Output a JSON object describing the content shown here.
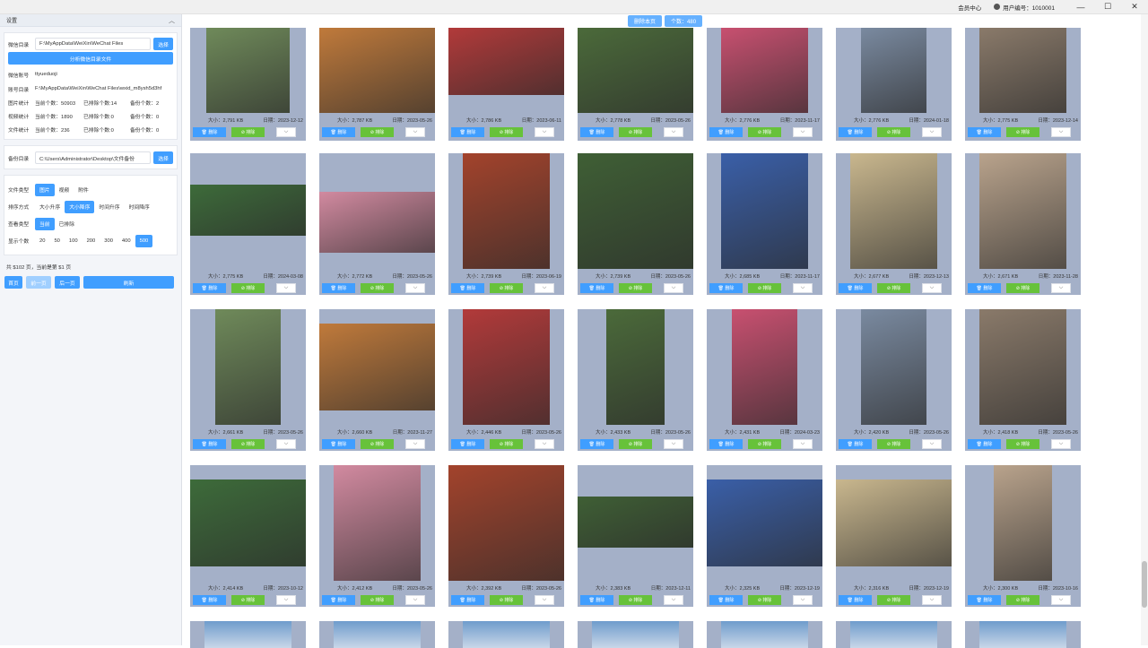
{
  "titlebar": {
    "member": "会员中心",
    "user": "用户编号：1010001",
    "min": "—",
    "max": "☐",
    "close": "✕"
  },
  "settings": {
    "title": "设置",
    "wechat_dir_label": "微信目录",
    "wechat_dir_value": "F:\\MyAppData\\WeiXin\\WeChat Files",
    "select_label": "选择",
    "analyze_label": "分析微信目录文件",
    "account_label": "微信账号",
    "account_value": "ttyueduoji",
    "acct_dir_label": "账号目录",
    "acct_dir_value": "F:\\MyAppData\\WeiXin\\WeChat Files\\wxid_m8ysh5d3hf",
    "stats": [
      {
        "label": "图片统计",
        "current": "当前个数：50903",
        "excluded": "已排除个数:14",
        "backup": "备份个数：2"
      },
      {
        "label": "视频统计",
        "current": "当前个数：1890",
        "excluded": "已排除个数:0",
        "backup": "备份个数：0"
      },
      {
        "label": "文件统计",
        "current": "当前个数：236",
        "excluded": "已排除个数:0",
        "backup": "备份个数：0"
      }
    ],
    "backup_dir_label": "备份目录",
    "backup_dir_value": "C:\\Users\\Administrator\\Desktop\\文件备份",
    "backup_select_label": "选择"
  },
  "filters": {
    "file_type_label": "文件类型",
    "file_types": [
      "图片",
      "视频",
      "附件"
    ],
    "sort_label": "排序方式",
    "sorts": [
      "大小升序",
      "大小降序",
      "时间升序",
      "时间降序"
    ],
    "view_label": "查看类型",
    "views": [
      "当前",
      "已排除"
    ],
    "count_label": "显示个数",
    "counts": [
      "20",
      "50",
      "100",
      "200",
      "300",
      "400",
      "500"
    ]
  },
  "pagination": {
    "info": "共 $102 页，当前是第 $1 页",
    "first": "首页",
    "prev": "前一页",
    "next": "后一页",
    "refresh": "刷新"
  },
  "toolbar": {
    "delete_page": "删除本页",
    "count": "个数：480"
  },
  "card_labels": {
    "size_prefix": "大小：",
    "date_prefix": "日期：",
    "delete": "删除",
    "exclude": "排除",
    "more": "⌵"
  },
  "colors": {
    "accent": "#409eff",
    "success": "#67c23a",
    "card_bg": "#a4b0c8"
  },
  "photos": [
    {
      "size": "2,791 KB",
      "date": "2023-12-12"
    },
    {
      "size": "2,787 KB",
      "date": "2023-05-26"
    },
    {
      "size": "2,786 KB",
      "date": "2023-06-11"
    },
    {
      "size": "2,778 KB",
      "date": "2023-05-26"
    },
    {
      "size": "2,776 KB",
      "date": "2023-11-17"
    },
    {
      "size": "2,776 KB",
      "date": "2024-01-18"
    },
    {
      "size": "2,775 KB",
      "date": "2023-12-14"
    },
    {
      "size": "2,775 KB",
      "date": "2024-03-08"
    },
    {
      "size": "2,772 KB",
      "date": "2023-05-26"
    },
    {
      "size": "2,739 KB",
      "date": "2023-06-19"
    },
    {
      "size": "2,739 KB",
      "date": "2023-05-26"
    },
    {
      "size": "2,685 KB",
      "date": "2023-11-17"
    },
    {
      "size": "2,677 KB",
      "date": "2023-12-13"
    },
    {
      "size": "2,671 KB",
      "date": "2023-11-28"
    },
    {
      "size": "2,661 KB",
      "date": "2023-05-26"
    },
    {
      "size": "2,660 KB",
      "date": "2023-11-27"
    },
    {
      "size": "2,446 KB",
      "date": "2023-05-26"
    },
    {
      "size": "2,433 KB",
      "date": "2023-05-26"
    },
    {
      "size": "2,431 KB",
      "date": "2024-03-23"
    },
    {
      "size": "2,420 KB",
      "date": "2023-05-26"
    },
    {
      "size": "2,418 KB",
      "date": "2023-05-26"
    },
    {
      "size": "2,414 KB",
      "date": "2023-10-12"
    },
    {
      "size": "2,412 KB",
      "date": "2023-05-26"
    },
    {
      "size": "2,392 KB",
      "date": "2023-05-26"
    },
    {
      "size": "2,383 KB",
      "date": "2023-12-11"
    },
    {
      "size": "2,325 KB",
      "date": "2023-12-19"
    },
    {
      "size": "2,316 KB",
      "date": "2023-12-19"
    },
    {
      "size": "2,300 KB",
      "date": "2023-10-16"
    }
  ]
}
